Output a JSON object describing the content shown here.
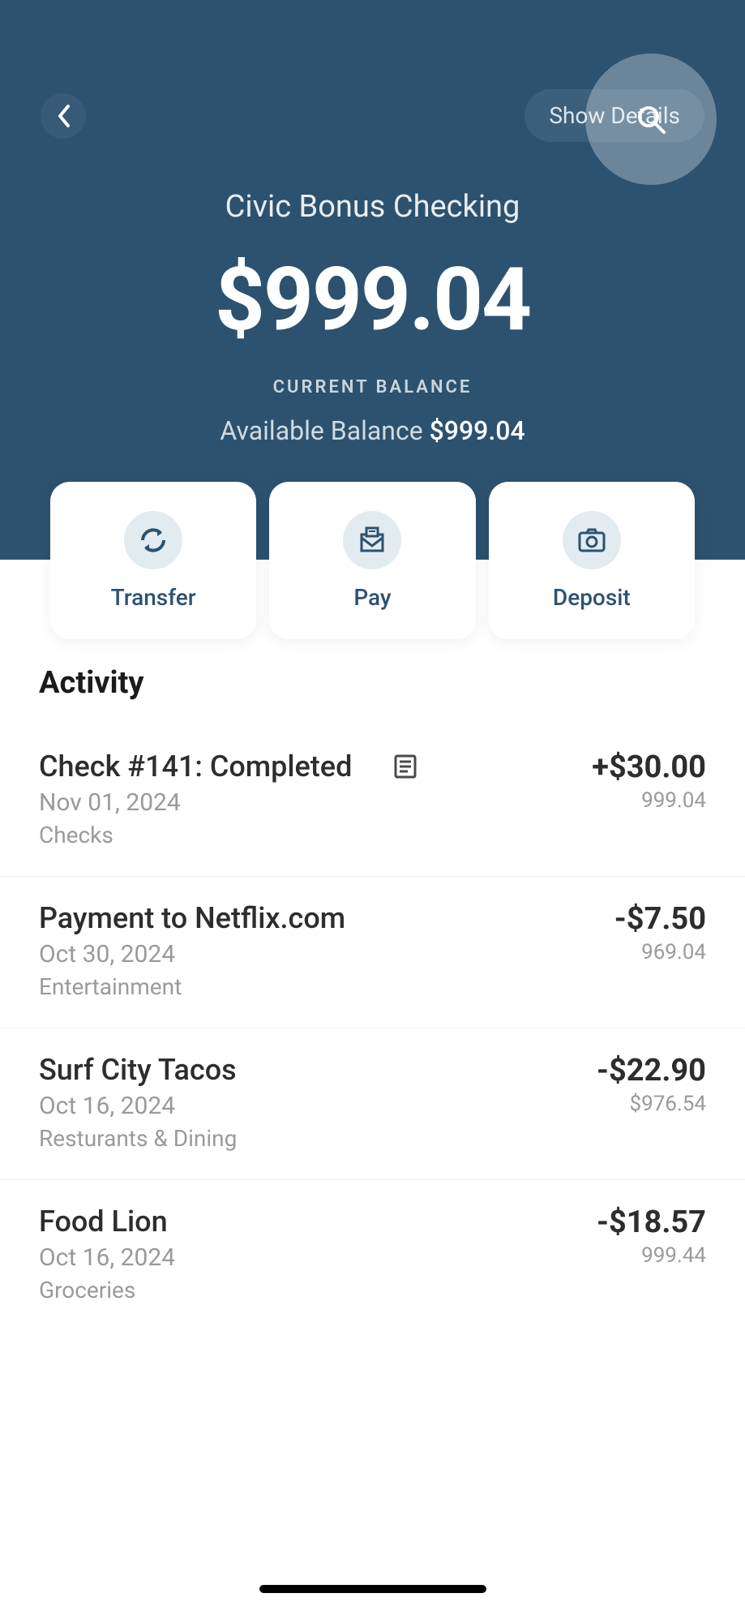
{
  "header": {
    "show_details": "Show Details",
    "account_name": "Civic Bonus Checking",
    "balance": "$999.04",
    "current_label": "CURRENT BALANCE",
    "available_label": "Available Balance",
    "available_amount": "$999.04"
  },
  "actions": {
    "transfer": "Transfer",
    "pay": "Pay",
    "deposit": "Deposit"
  },
  "activity": {
    "header": "Activity",
    "items": [
      {
        "title": "Check #141: Completed",
        "date": "Nov 01, 2024",
        "category": "Checks",
        "amount": "+$30.00",
        "running": "999.04",
        "has_doc_icon": true
      },
      {
        "title": "Payment to Netflix.com",
        "date": "Oct 30, 2024",
        "category": "Entertainment",
        "amount": "-$7.50",
        "running": "969.04",
        "has_doc_icon": false
      },
      {
        "title": "Surf City Tacos",
        "date": "Oct 16, 2024",
        "category": "Resturants & Dining",
        "amount": "-$22.90",
        "running": "$976.54",
        "has_doc_icon": false
      },
      {
        "title": "Food Lion",
        "date": "Oct 16, 2024",
        "category": "Groceries",
        "amount": "-$18.57",
        "running": "999.44",
        "has_doc_icon": false
      }
    ]
  }
}
